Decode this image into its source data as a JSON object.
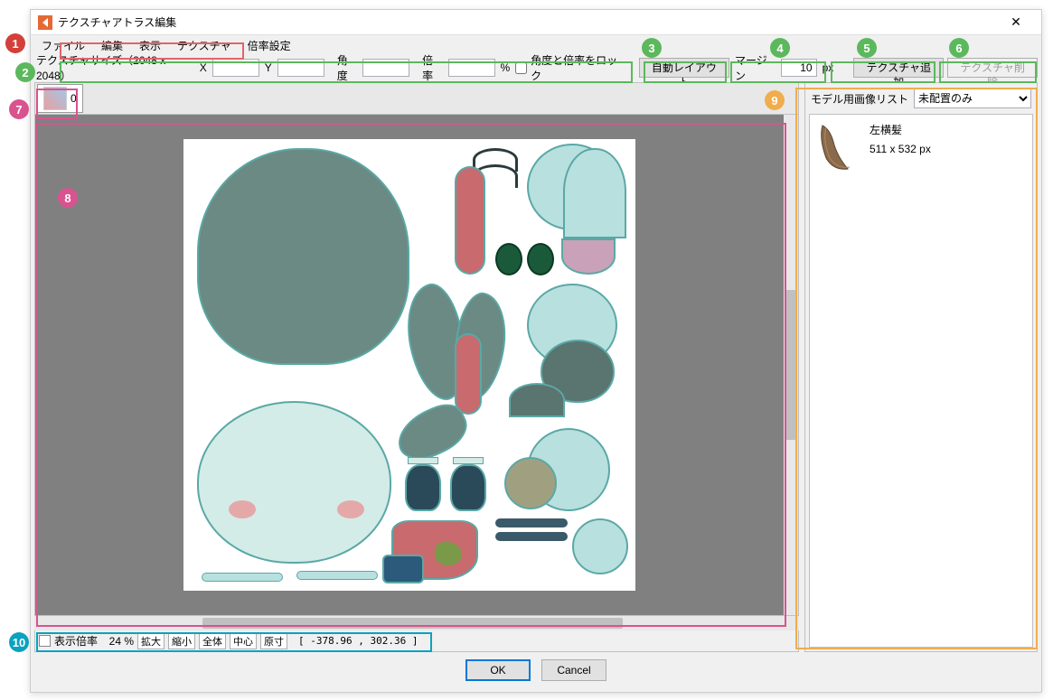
{
  "window": {
    "title": "テクスチャアトラス編集"
  },
  "menu": {
    "file": "ファイル",
    "edit": "編集",
    "view": "表示",
    "texture": "テクスチャ",
    "scale": "倍率設定"
  },
  "toolbar": {
    "size_label": "テクスチャサイズ（2048 x 2048）",
    "x_label": "X",
    "x_val": "",
    "y_label": "Y",
    "y_val": "",
    "angle_label": "角度",
    "angle_val": "",
    "scale_label": "倍率",
    "scale_val": "",
    "scale_unit": "%",
    "lock_label": "角度と倍率をロック",
    "auto_layout": "自動レイアウト",
    "margin_label": "マージン",
    "margin_val": "10",
    "margin_unit": "px",
    "add_texture": "テクスチャ追加",
    "del_texture": "テクスチャ削除"
  },
  "tabs": [
    {
      "index": "0"
    }
  ],
  "right": {
    "list_label": "モデル用画像リスト",
    "filter_selected": "未配置のみ",
    "items": [
      {
        "name": "左横髪",
        "dims": "511 x 532 px"
      }
    ]
  },
  "status": {
    "zoom_label": "表示倍率",
    "zoom_val": "24 %",
    "zoom_in": "拡大",
    "zoom_out": "縮小",
    "fit_all": "全体",
    "center": "中心",
    "actual": "原寸",
    "coords": "[ -378.96 , 302.36 ]"
  },
  "buttons": {
    "ok": "OK",
    "cancel": "Cancel"
  },
  "callouts": {
    "c1": "1",
    "c2": "2",
    "c3": "3",
    "c4": "4",
    "c5": "5",
    "c6": "6",
    "c7": "7",
    "c8": "8",
    "c9": "9",
    "c10": "10"
  }
}
